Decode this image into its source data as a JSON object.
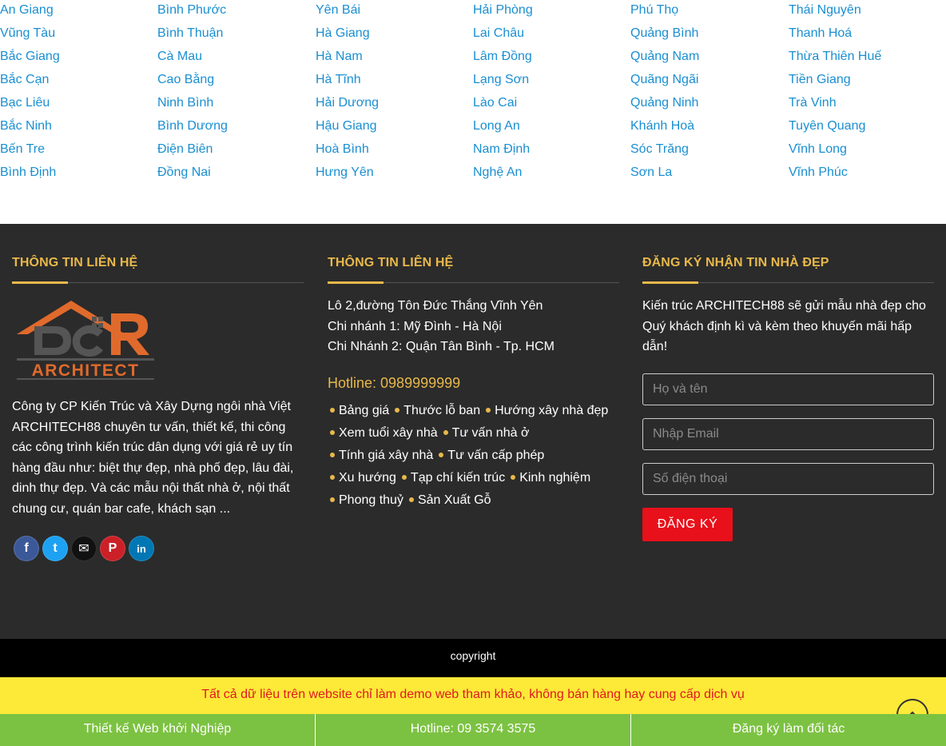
{
  "provinces": [
    [
      "An Giang",
      "Vũng Tàu",
      "Bắc Giang",
      "Bắc Cạn",
      "Bạc Liêu",
      "Bắc Ninh",
      "Bến Tre",
      "Bình Định"
    ],
    [
      "Bình Phước",
      "Bình Thuận",
      "Cà Mau",
      "Cao Bằng",
      "Ninh Bình",
      "Bình Dương",
      "Điện Biên",
      "Đồng Nai"
    ],
    [
      "Yên Bái",
      "Hà Giang",
      "Hà Nam",
      "Hà Tĩnh",
      "Hải Dương",
      "Hậu Giang",
      "Hoà Bình",
      "Hưng Yên"
    ],
    [
      "Hải Phòng",
      "Lai Châu",
      "Lâm Đồng",
      "Lạng Sơn",
      "Lào Cai",
      "Long An",
      "Nam Định",
      "Nghệ An"
    ],
    [
      "Phú Thọ",
      "Quảng Bình",
      "Quảng Nam",
      "Quãng Ngãi",
      "Quảng Ninh",
      "Khánh Hoà",
      "Sóc Trăng",
      "Sơn La"
    ],
    [
      "Thái Nguyên",
      "Thanh Hoá",
      "Thừa Thiên Huế",
      "Tiền Giang",
      "Trà Vinh",
      "Tuyên Quang",
      "Vĩnh Long",
      "Vĩnh Phúc"
    ]
  ],
  "colors": {
    "link_blue": "#1a8fd1",
    "footer_bg": "#2b2b2b",
    "accent_gold": "#e8b84a",
    "logo_orange": "#e06a2c",
    "logo_gray": "#555555",
    "submit_red": "#e8101a",
    "notice_yellow": "#fde938",
    "notice_red": "#e0191f",
    "bottombar_green": "#7cc242"
  },
  "footer": {
    "col1": {
      "title": "THÔNG TIN LIÊN HỆ",
      "logo_text": "ARCHITECT",
      "about": "Công ty CP Kiến Trúc và Xây Dựng ngôi nhà Việt ARCHITECH88 chuyên tư vấn, thiết kế, thi công các công trình kiến trúc dân dụng với giá rẻ uy tín hàng đầu như: biệt thự đẹp, nhà phố đẹp, lâu đài, dinh thự đẹp. Và các mẫu nội thất nhà ở, nội thất chung cư, quán bar cafe, khách sạn ...",
      "socials": [
        {
          "icon": "facebook-icon",
          "glyph": "f",
          "color": "#3b5998"
        },
        {
          "icon": "twitter-icon",
          "glyph": "t",
          "color": "#1da1f2"
        },
        {
          "icon": "email-icon",
          "glyph": "✉",
          "color": "#111111"
        },
        {
          "icon": "pinterest-icon",
          "glyph": "P",
          "color": "#cb2027"
        },
        {
          "icon": "linkedin-icon",
          "glyph": "in",
          "color": "#0077b5"
        }
      ]
    },
    "col2": {
      "title": "THÔNG TIN LIÊN HỆ",
      "address_lines": [
        "Lô 2,đường Tôn Đức Thắng Vĩnh Yên",
        "Chi nhánh 1: Mỹ Đình - Hà Nội",
        "Chi Nhánh 2: Quận Tân Bình - Tp. HCM"
      ],
      "hotline": "Hotline: 0989999999",
      "link_rows": [
        [
          "Bảng giá",
          "Thước lỗ ban",
          "Hướng xây nhà đẹp"
        ],
        [
          "Xem tuổi xây nhà",
          "Tư vấn nhà ở"
        ],
        [
          "Tính giá xây nhà",
          "Tư vấn cấp phép"
        ],
        [
          "Xu hướng",
          "Tạp chí kiến trúc",
          "Kinh nghiệm"
        ],
        [
          "Phong thuỷ",
          "Sản Xuất Gỗ"
        ]
      ]
    },
    "col3": {
      "title": "ĐĂNG KÝ NHẬN TIN NHÀ ĐẸP",
      "description": "Kiến trúc ARCHITECH88 sẽ gửi mẫu nhà đẹp cho Quý khách định kì và kèm theo khuyến mãi hấp dẫn!",
      "name_placeholder": "Họ và tên",
      "email_placeholder": "Nhập Email",
      "phone_placeholder": "Số điện thoại",
      "submit_label": "ĐĂNG KÝ"
    }
  },
  "copyright": "copyright",
  "notice": "Tất cả dữ liệu trên website chỉ làm demo web tham khảo, không bán hàng hay cung cấp dịch vụ",
  "bottom_bar": [
    "Thiết kế Web khởi Nghiệp",
    "Hotline: 09 3574 3575",
    "Đăng ký làm đối tác"
  ]
}
